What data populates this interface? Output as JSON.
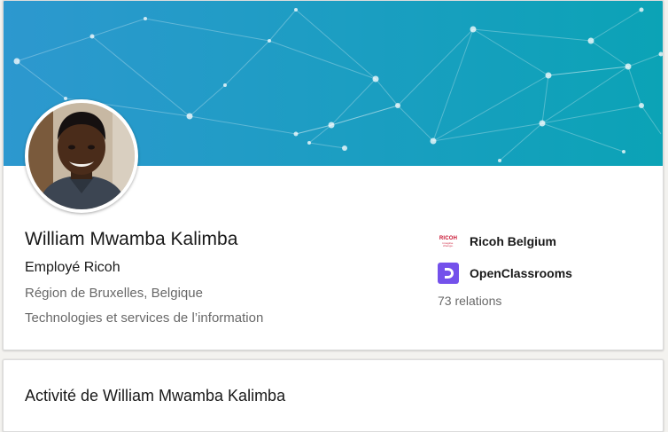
{
  "profile": {
    "name": "William Mwamba Kalimba",
    "headline": "Employé Ricoh",
    "location": "Région de Bruxelles, Belgique",
    "industry": "Technologies et services de l’information",
    "organizations": [
      {
        "name": "Ricoh Belgium",
        "logo_icon": "ricoh-logo",
        "logo_text": "RICOH",
        "logo_tagline": "imagine. change.",
        "logo_color": "#c8102e"
      },
      {
        "name": "OpenClassrooms",
        "logo_icon": "openclassrooms-logo",
        "logo_color": "#7451eb"
      }
    ],
    "connections": "73 relations"
  },
  "banner": {
    "icon": "network-nodes-banner",
    "color_start": "#2e9bd2",
    "color_end": "#0aa5b5"
  },
  "activity": {
    "title": "Activité de William Mwamba Kalimba"
  }
}
